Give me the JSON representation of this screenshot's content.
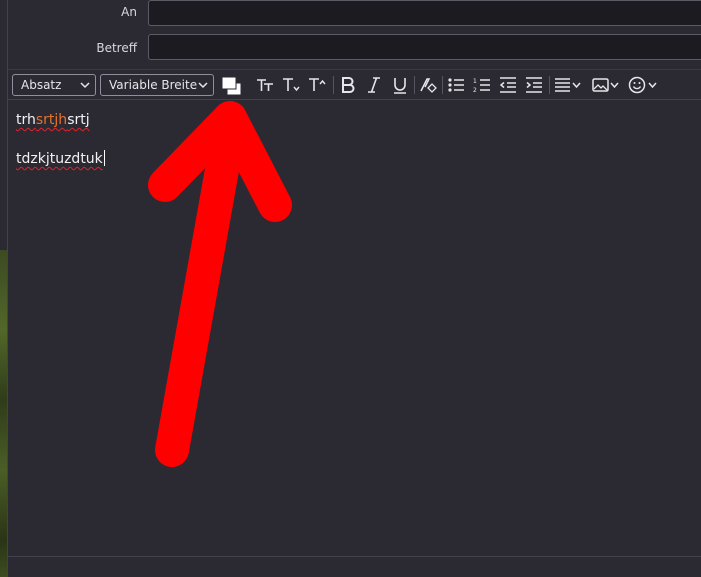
{
  "header": {
    "to_label": "An",
    "to_value": "",
    "subject_label": "Betreff",
    "subject_value": ""
  },
  "toolbar": {
    "paragraph_format": "Absatz",
    "font": "Variable Breite",
    "icons": [
      "text-color-icon",
      "font-size-icon",
      "smaller-font-icon",
      "larger-font-icon",
      "bold-icon",
      "italic-icon",
      "underline-icon",
      "clear-formatting-icon",
      "bullet-list-icon",
      "numbered-list-icon",
      "outdent-icon",
      "indent-icon",
      "align-icon",
      "insert-image-icon",
      "emoji-icon"
    ]
  },
  "editor": {
    "line1": {
      "part1": "trh",
      "part2": "srtjh",
      "part3": "srtj"
    },
    "line2": "tdzkjtuzdtuk"
  },
  "colors": {
    "background": "#2b2a33",
    "field_bg": "#1c1b22",
    "text": "#f1f1f3",
    "highlight_text": "#e8732a",
    "spellcheck": "#e0242b",
    "arrow": "#ff0000"
  },
  "annotation": {
    "type": "arrow",
    "color": "#ff0000",
    "points_to": "text-color-icon"
  }
}
